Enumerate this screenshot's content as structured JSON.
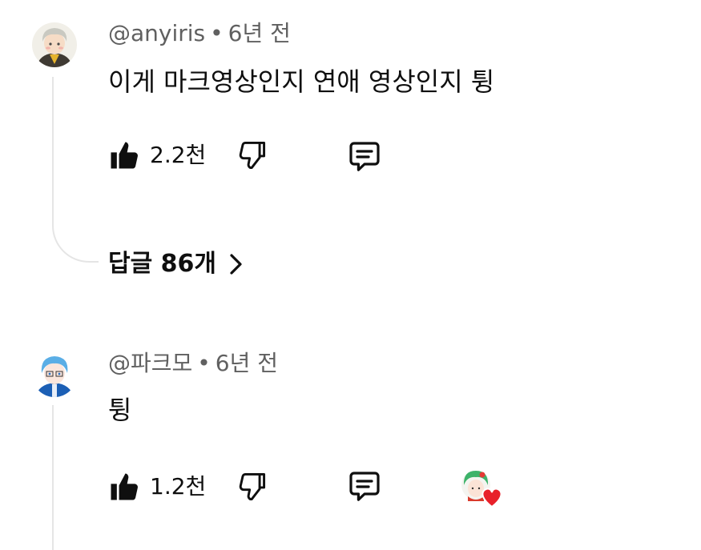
{
  "comments": [
    {
      "handle": "@anyiris",
      "separator": "•",
      "time": "6년 전",
      "text": "이게 마크영상인지 연애 영상인지 튕",
      "likes": "2.2천",
      "icons": {
        "like": "thumbs-up-icon",
        "dislike": "thumbs-down-icon",
        "reply": "reply-comment-icon"
      }
    },
    {
      "handle": "@파크모",
      "separator": "•",
      "time": "6년 전",
      "text": "튕",
      "likes": "1.2천",
      "icons": {
        "like": "thumbs-up-icon",
        "dislike": "thumbs-down-icon",
        "reply": "reply-comment-icon",
        "hearted": "creator-heart-icon"
      }
    }
  ],
  "replies": {
    "label": "답글 86개",
    "icon": "chevron-right-icon"
  },
  "colors": {
    "text": "#0f0f0f",
    "secondary": "#606060",
    "thread": "#e5e5e5",
    "heart": "#e8202a"
  }
}
